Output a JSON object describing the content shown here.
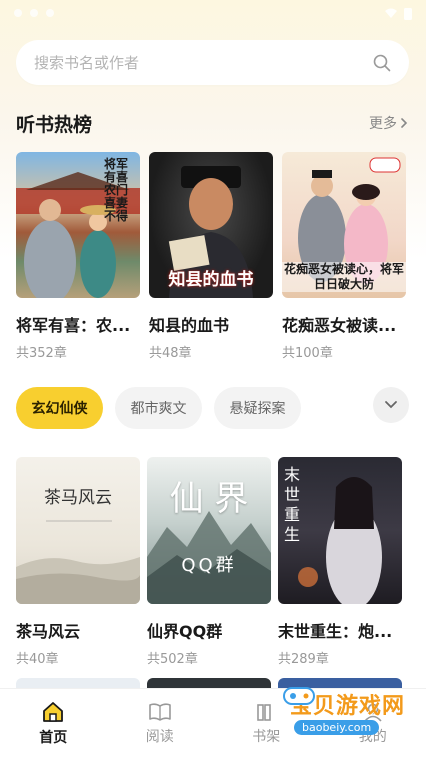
{
  "search": {
    "placeholder": "搜索书名或作者"
  },
  "hot": {
    "title": "听书热榜",
    "more_label": "更多",
    "books": [
      {
        "title": "将军有喜：农...",
        "chapters": "共352章",
        "cover_text": "将军有喜农门喜妻不得"
      },
      {
        "title": "知县的血书",
        "chapters": "共48章",
        "cover_text": "知县的血书"
      },
      {
        "title": "花痴恶女被读...",
        "chapters": "共100章",
        "cover_text": "花痴恶女被读心，将军日日破大防"
      }
    ]
  },
  "categories": {
    "chips": [
      "玄幻仙侠",
      "都市爽文",
      "悬疑探案"
    ],
    "active_index": 0
  },
  "grid": {
    "books": [
      {
        "title": "茶马风云",
        "chapters": "共40章",
        "cover_text": "茶马风云"
      },
      {
        "title": "仙界QQ群",
        "chapters": "共502章",
        "cover_text_main": "仙 界",
        "cover_text_sub": "QQ群"
      },
      {
        "title": "末世重生：炮...",
        "chapters": "共289章",
        "cover_text": "末世重生"
      }
    ]
  },
  "tabs": [
    {
      "label": "首页",
      "icon": "home-icon",
      "active": true
    },
    {
      "label": "阅读",
      "icon": "book-open-icon",
      "active": false
    },
    {
      "label": "书架",
      "icon": "bookshelf-icon",
      "active": false
    },
    {
      "label": "我的",
      "icon": "profile-icon",
      "active": false
    }
  ],
  "watermark": {
    "title": "宝贝游戏网",
    "url": "baobeiy.com"
  },
  "colors": {
    "accent": "#f8cf2f",
    "text": "#1a1a1a",
    "muted": "#999999"
  }
}
